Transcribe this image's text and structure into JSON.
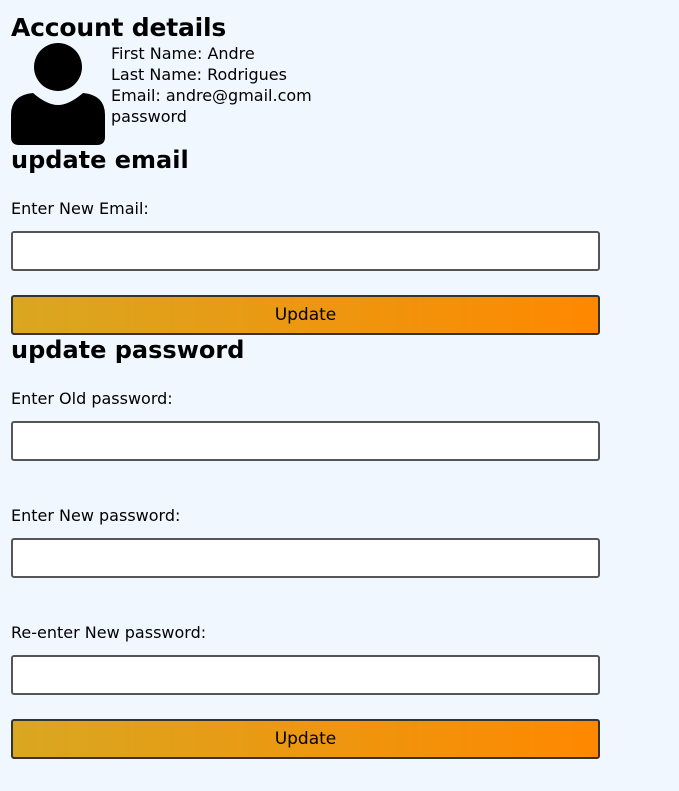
{
  "account": {
    "title": "Account details",
    "first_name": "First Name: Andre",
    "last_name": "Last Name: Rodrigues",
    "email": "Email: andre@gmail.com",
    "password": "password",
    "avatar_icon": "user-avatar-icon"
  },
  "update_email": {
    "title": "update email",
    "label": "Enter New Email:",
    "value": "",
    "button_label": "Update"
  },
  "update_password": {
    "title": "update password",
    "old_label": "Enter Old password:",
    "old_value": "",
    "new_label": "Enter New password:",
    "new_value": "",
    "confirm_label": "Re-enter New password:",
    "confirm_value": "",
    "button_label": "Update"
  },
  "colors": {
    "background": "#f0f7ff",
    "button_gradient_start": "#d9a721",
    "button_gradient_end": "#ff8800"
  }
}
